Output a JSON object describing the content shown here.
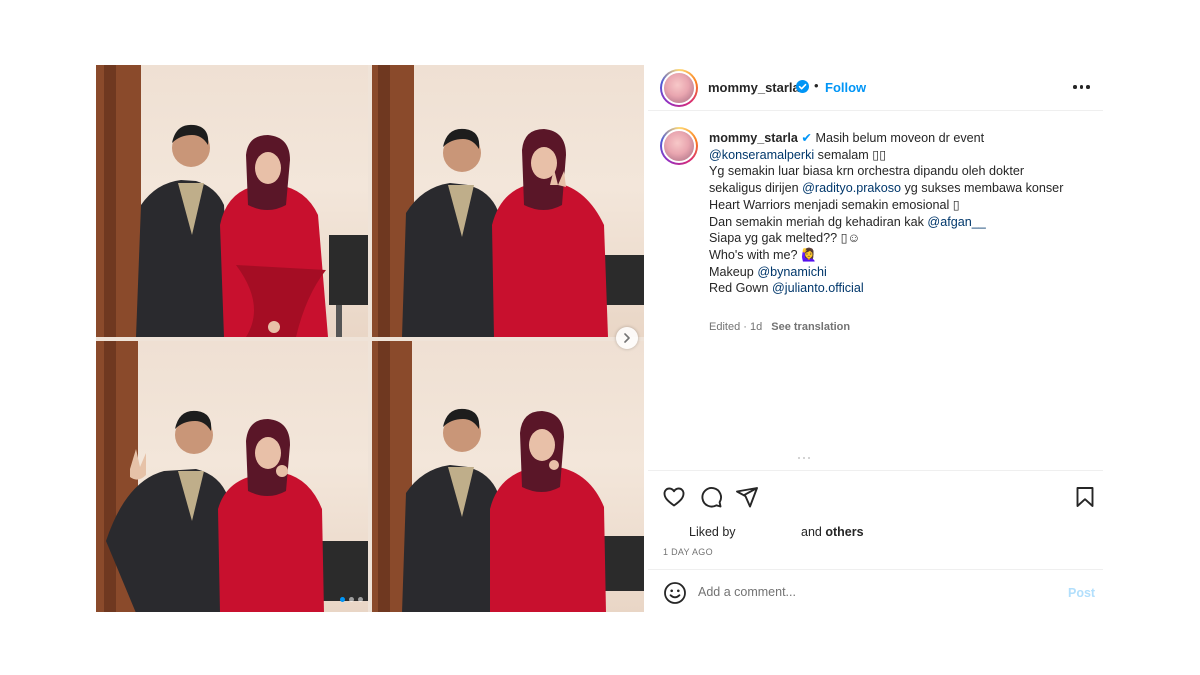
{
  "post": {
    "username": "mommy_starla",
    "separator": "•",
    "follow_label": "Follow",
    "caption_lines": [
      {
        "parts": [
          {
            "t": "mommy_starla",
            "k": "u"
          },
          {
            "t": " ✔",
            "k": "v"
          },
          {
            "t": " Masih belum moveon dr event",
            "k": "p"
          }
        ]
      },
      {
        "parts": [
          {
            "t": "@konseramalperki",
            "k": "m"
          },
          {
            "t": " semalam ",
            "k": "p"
          },
          {
            "t": "▯▯",
            "k": "p"
          }
        ]
      },
      {
        "parts": [
          {
            "t": "Yg semakin luar biasa krn orchestra dipandu oleh dokter",
            "k": "p"
          }
        ]
      },
      {
        "parts": [
          {
            "t": "sekaligus dirijen ",
            "k": "p"
          },
          {
            "t": "@radityo.prakoso",
            "k": "m"
          },
          {
            "t": " yg sukses membawa konser",
            "k": "p"
          }
        ]
      },
      {
        "parts": [
          {
            "t": "Heart Warriors menjadi semakin emosional ",
            "k": "p"
          },
          {
            "t": "▯",
            "k": "p"
          }
        ]
      },
      {
        "parts": [
          {
            "t": "Dan semakin meriah dg kehadiran kak ",
            "k": "p"
          },
          {
            "t": "@afgan__",
            "k": "m"
          }
        ]
      },
      {
        "parts": [
          {
            "t": "Siapa yg gak melted?? ",
            "k": "p"
          },
          {
            "t": "▯☺",
            "k": "p"
          }
        ]
      },
      {
        "parts": [
          {
            "t": "Who's with me? ",
            "k": "p"
          },
          {
            "t": "🙋‍♀",
            "k": "p"
          }
        ]
      },
      {
        "parts": [
          {
            "t": " ",
            "k": "p"
          }
        ]
      },
      {
        "parts": [
          {
            "t": "Makeup ",
            "k": "p"
          },
          {
            "t": "@bynamichi",
            "k": "m"
          }
        ]
      },
      {
        "parts": [
          {
            "t": "Red Gown ",
            "k": "p"
          },
          {
            "t": "@julianto.official",
            "k": "m"
          }
        ]
      }
    ],
    "edited": "Edited · 1d",
    "see_translation": "See translation",
    "liked_by": "Liked by",
    "and_label": "and",
    "others_label": "others",
    "time_ago": "1 DAY AGO",
    "comment_placeholder": "Add a comment...",
    "post_label": "Post"
  },
  "icons": {
    "verified": "verified-badge-icon",
    "more": "more-options-icon",
    "like": "heart-icon",
    "comment": "comment-icon",
    "share": "share-icon",
    "save": "bookmark-icon",
    "emoji": "emoji-icon",
    "next": "chevron-right-icon"
  },
  "colors": {
    "accent": "#0095f6",
    "mention": "#00376b",
    "muted": "#737373",
    "gown": "#c8102e"
  },
  "carousel": {
    "slides": 3,
    "active": 1
  }
}
